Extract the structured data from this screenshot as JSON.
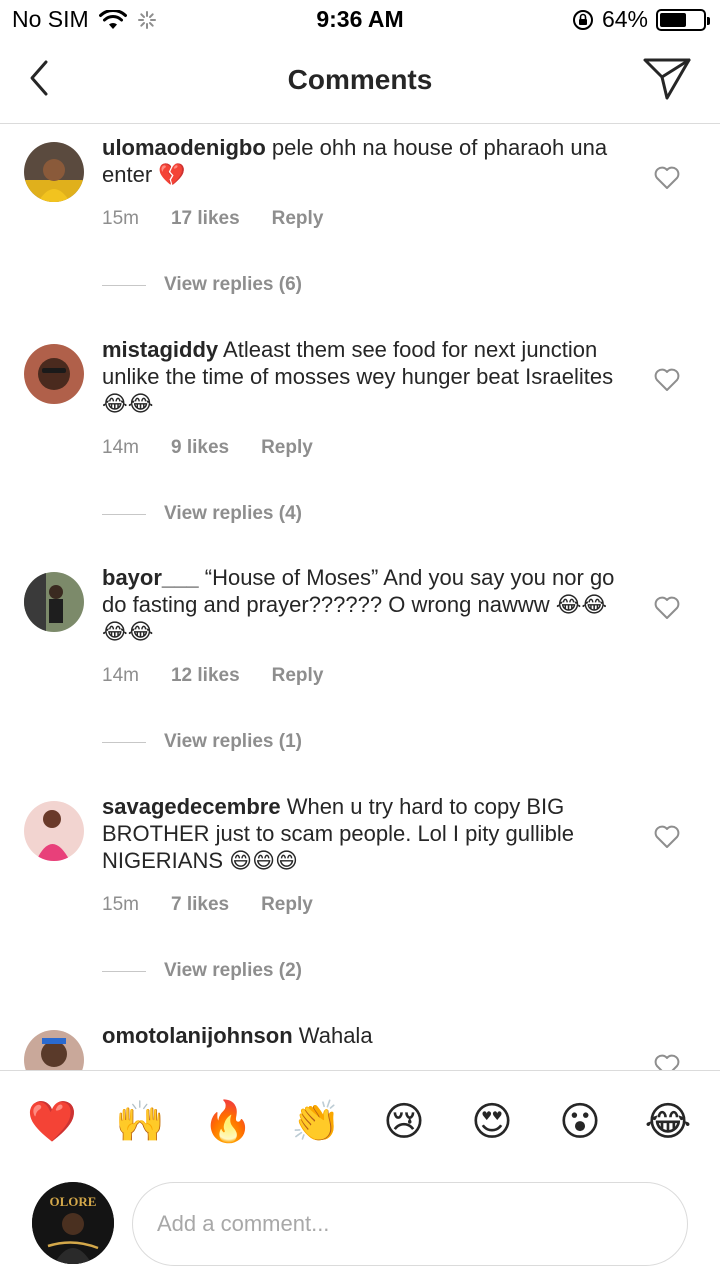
{
  "status_bar": {
    "carrier": "No SIM",
    "time": "9:36 AM",
    "battery_percent": "64%",
    "battery_level": 0.64
  },
  "header": {
    "title": "Comments"
  },
  "comments": [
    {
      "username": "ulomaodenigbo",
      "text": "pele ohh na house of pharaoh una enter 💔",
      "time": "15m",
      "likes": "17 likes",
      "reply": "Reply",
      "view_replies": "View replies (6)"
    },
    {
      "username": "mistagiddy",
      "text": "Atleast them see food for next junction unlike the time of mosses wey hunger beat Israelites 😂😂",
      "time": "14m",
      "likes": "9 likes",
      "reply": "Reply",
      "view_replies": "View replies (4)"
    },
    {
      "username": "bayor___",
      "text": "“House of Moses” And you say you nor go do fasting and prayer?????? O wrong nawww 😂😂😂😂",
      "time": "14m",
      "likes": "12 likes",
      "reply": "Reply",
      "view_replies": "View replies (1)"
    },
    {
      "username": "savagedecembre",
      "text": "When u try hard to copy BIG BROTHER just to scam people. Lol I pity gullible NIGERIANS 😄😄😄",
      "time": "15m",
      "likes": "7 likes",
      "reply": "Reply",
      "view_replies": "View replies (2)"
    },
    {
      "username": "omotolanijohnson",
      "text": "Wahala"
    }
  ],
  "emoji_bar": [
    "❤️",
    "🙌",
    "🔥",
    "👏",
    "😢",
    "😍",
    "😮",
    "😂"
  ],
  "composer": {
    "placeholder": "Add a comment...",
    "avatar_text": "OLORE"
  }
}
